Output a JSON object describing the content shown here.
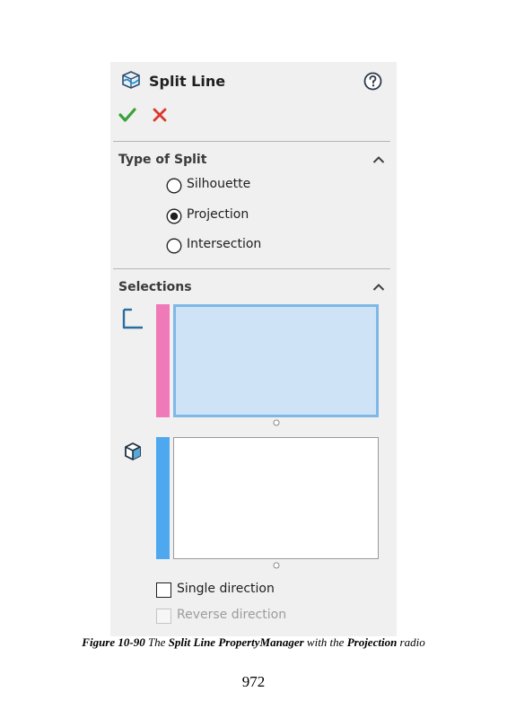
{
  "property_manager": {
    "title": "Split Line",
    "sections": {
      "type_of_split": {
        "title": "Type of Split",
        "options": [
          {
            "label": "Silhouette",
            "selected": false
          },
          {
            "label": "Projection",
            "selected": true
          },
          {
            "label": "Intersection",
            "selected": false
          }
        ]
      },
      "selections": {
        "title": "Selections",
        "single_direction_label": "Single direction",
        "reverse_direction_label": "Reverse direction"
      }
    },
    "colors": {
      "sketch_bar": "#f07ab8",
      "face_bar": "#4ea8f0",
      "ok_green": "#3aa13a",
      "cancel_red": "#d93a2e"
    },
    "icons": [
      "split-line-feature-icon",
      "help-icon",
      "ok-checkmark-icon",
      "cancel-x-icon",
      "collapse-chevron-icon",
      "sketch-icon",
      "face-cube-icon"
    ]
  },
  "caption": {
    "figure_label": "Figure 10-90",
    "text_1": " The ",
    "bold_1": "Split Line PropertyManager",
    "text_2": " with the ",
    "bold_2": "Projection",
    "text_3": " radio"
  },
  "page_number": "972"
}
